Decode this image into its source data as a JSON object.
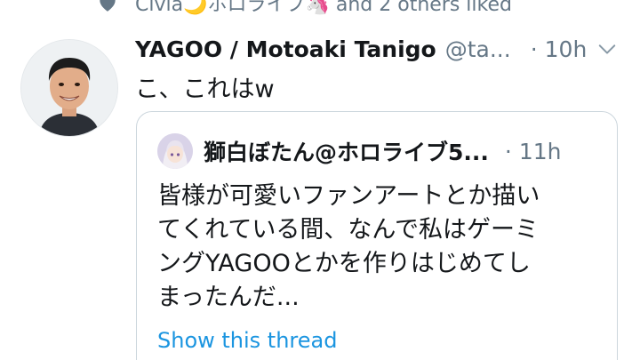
{
  "social_context": {
    "text": "Civia🌙ホロライブ🦄 and 2 others liked",
    "icon": "heart-icon"
  },
  "tweet": {
    "author_name": "YAGOO / Motoaki Tanigo",
    "author_handle": "@ta...",
    "separator": "·",
    "time": "10h",
    "text": "こ、これはw"
  },
  "quoted_tweet": {
    "author_name": "獅白ぼたん@ホロライブ5...",
    "separator": "·",
    "time": "11h",
    "lines": [
      "皆様が可愛いファンアートとか描い",
      "てくれている間、なんで私はゲーミ",
      "ングYAGOOとかを作りはじめてし",
      "まったんだ..."
    ],
    "show_thread": "Show this thread"
  },
  "colors": {
    "text": "#14171a",
    "muted": "#657786",
    "link": "#1b95e0",
    "border": "#ccd6dd"
  }
}
